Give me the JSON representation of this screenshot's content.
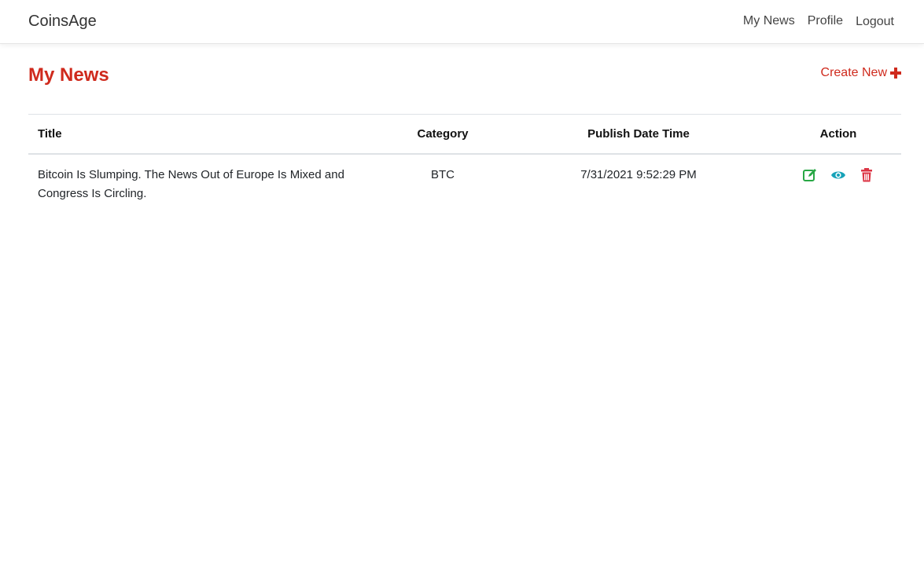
{
  "navbar": {
    "brand": "CoinsAge",
    "links": [
      "My News",
      "Profile",
      "Logout"
    ]
  },
  "page": {
    "title": "My News",
    "create_new_label": "Create New"
  },
  "table": {
    "headers": [
      "Title",
      "Category",
      "Publish Date Time",
      "Action"
    ],
    "rows": [
      {
        "title": "Bitcoin Is Slumping. The News Out of Europe Is Mixed and Congress Is Circling.",
        "category": "BTC",
        "publish_date_time": "7/31/2021 9:52:29 PM",
        "actions": [
          "edit-icon",
          "view-icon",
          "delete-icon"
        ]
      }
    ]
  },
  "colors": {
    "accent": "#cf2a1d",
    "edit": "#28a745",
    "view": "#17a2b8",
    "delete": "#dc3545"
  }
}
